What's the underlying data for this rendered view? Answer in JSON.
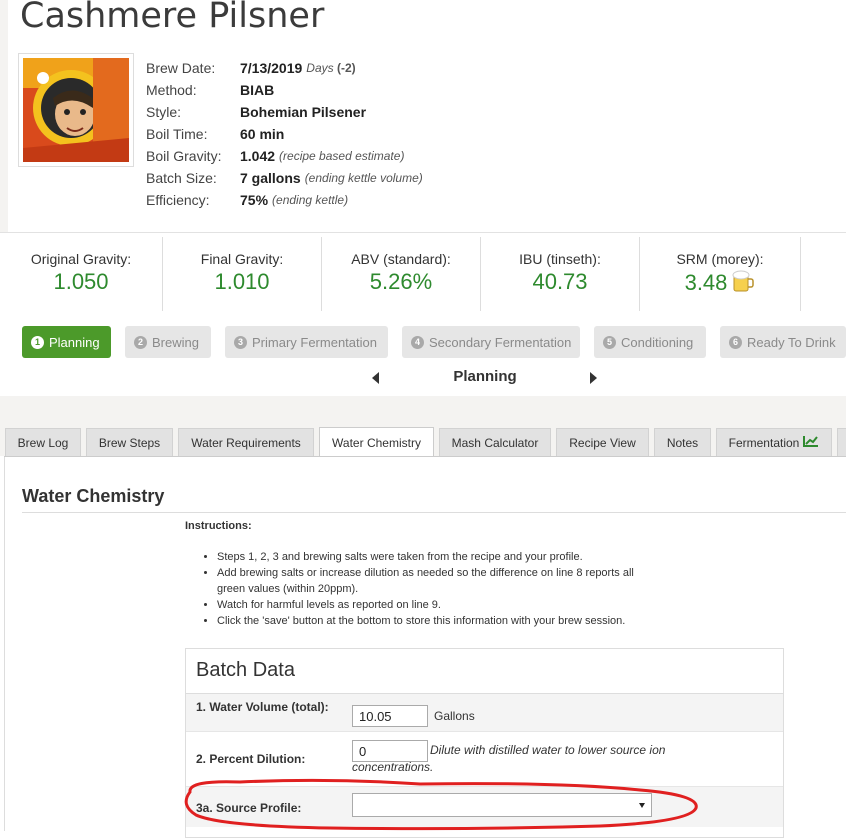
{
  "recipe": {
    "title": "Cashmere Pilsner",
    "details": [
      {
        "label": "Brew Date:",
        "value": "7/13/2019",
        "note_pre": "Days ",
        "note_bold": "(-2)",
        "note": ""
      },
      {
        "label": "Method:",
        "value": "BIAB",
        "note": ""
      },
      {
        "label": "Style:",
        "value": "Bohemian Pilsener",
        "note": ""
      },
      {
        "label": "Boil Time:",
        "value": "60 min",
        "note": ""
      },
      {
        "label": "Boil Gravity:",
        "value": "1.042",
        "note": "(recipe based estimate)"
      },
      {
        "label": "Batch Size:",
        "value": "7 gallons",
        "note": "(ending kettle volume)"
      },
      {
        "label": "Efficiency:",
        "value": "75%",
        "note": "(ending kettle)"
      }
    ]
  },
  "stats": [
    {
      "label": "Original Gravity:",
      "value": "1.050"
    },
    {
      "label": "Final Gravity:",
      "value": "1.010"
    },
    {
      "label": "ABV (standard):",
      "value": "5.26%"
    },
    {
      "label": "IBU (tinseth):",
      "value": "40.73"
    },
    {
      "label": "SRM (morey):",
      "value": "3.48",
      "icon": "beer-mug-icon"
    }
  ],
  "progress": {
    "steps": [
      {
        "num": "1",
        "label": "Planning",
        "active": true
      },
      {
        "num": "2",
        "label": "Brewing"
      },
      {
        "num": "3",
        "label": "Primary Fermentation"
      },
      {
        "num": "4",
        "label": "Secondary Fermentation"
      },
      {
        "num": "5",
        "label": "Conditioning"
      },
      {
        "num": "6",
        "label": "Ready To Drink"
      }
    ],
    "current_phase": "Planning"
  },
  "tabs": [
    {
      "label": "Brew Log"
    },
    {
      "label": "Brew Steps"
    },
    {
      "label": "Water Requirements"
    },
    {
      "label": "Water Chemistry",
      "active": true
    },
    {
      "label": "Mash Calculator"
    },
    {
      "label": "Recipe View"
    },
    {
      "label": "Notes"
    },
    {
      "label": "Fermentation",
      "icon": "chart-icon"
    }
  ],
  "water_chemistry": {
    "title": "Water Chemistry",
    "instructions_heading": "Instructions:",
    "instructions": [
      "Steps 1, 2, 3 and brewing salts were taken from the recipe and your profile.",
      "Add brewing salts or increase dilution as needed so the difference on line 8 reports all green values (within 20ppm).",
      "Watch for harmful levels as reported on line 9.",
      "Click the 'save' button at the bottom to store this information with your brew session."
    ],
    "batch_data": {
      "title": "Batch Data",
      "water_volume": {
        "label": "1. Water Volume (total):",
        "value": "10.05",
        "unit": "Gallons"
      },
      "percent_dilution": {
        "label": "2. Percent Dilution:",
        "value": "0",
        "hint": "Dilute with distilled water to lower source ion concentrations."
      },
      "source_profile": {
        "label": "3a. Source Profile:",
        "value": ""
      }
    }
  },
  "colors": {
    "accent_green": "#4c9a2a",
    "value_green": "#2e8a2e",
    "annotation_red": "#e02020"
  }
}
